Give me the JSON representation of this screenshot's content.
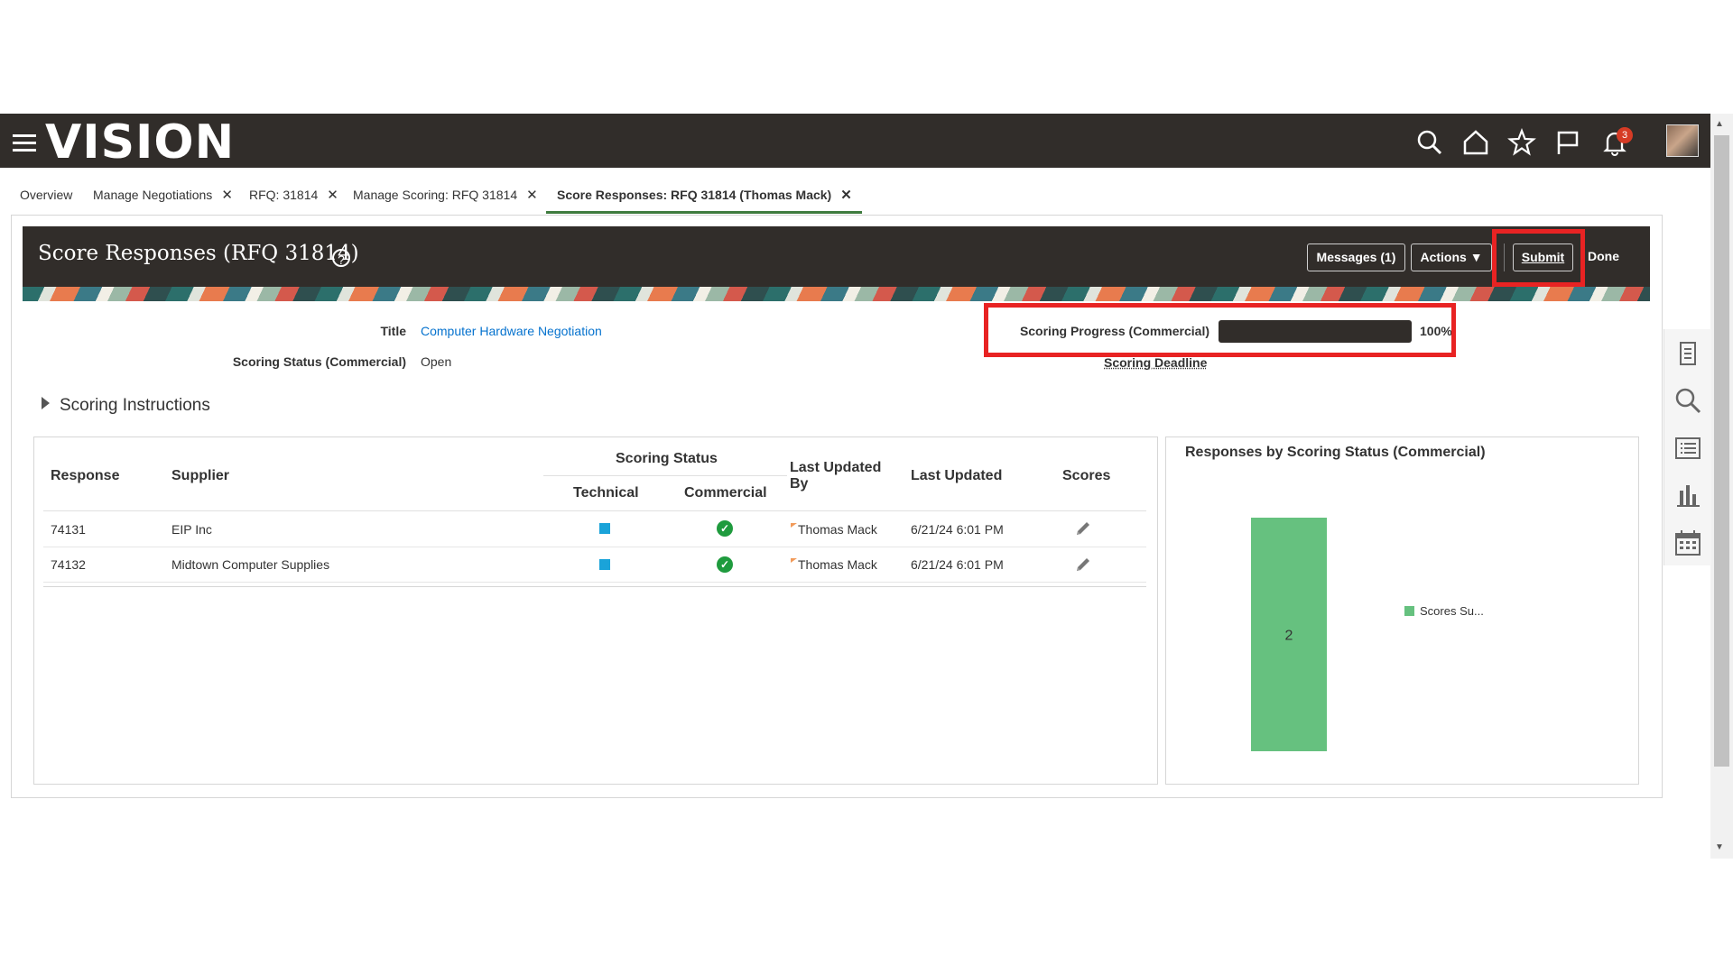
{
  "header": {
    "logo": "VISION",
    "notifications_count": "3",
    "icons": [
      "menu-icon",
      "search-icon",
      "home-icon",
      "star-icon",
      "flag-icon",
      "bell-icon",
      "avatar"
    ]
  },
  "tabs": [
    {
      "label": "Overview",
      "closable": false
    },
    {
      "label": "Manage Negotiations",
      "closable": true
    },
    {
      "label": "RFQ: 31814",
      "closable": true
    },
    {
      "label": "Manage Scoring: RFQ 31814",
      "closable": true
    },
    {
      "label": "Score Responses: RFQ 31814 (Thomas Mack)",
      "closable": true,
      "active": true
    }
  ],
  "page": {
    "title": "Score Responses (RFQ 31814)",
    "help": "?",
    "buttons": {
      "messages": "Messages (1)",
      "actions": "Actions",
      "submit": "Submit",
      "done": "Done"
    }
  },
  "fields": {
    "title_label": "Title",
    "title_value": "Computer Hardware Negotiation",
    "status_label": "Scoring Status (Commercial)",
    "status_value": "Open",
    "progress_label": "Scoring Progress (Commercial)",
    "progress_value": "100%",
    "progress_fraction": 1.0,
    "deadline_label": "Scoring Deadline"
  },
  "instructions": {
    "label": "Scoring Instructions"
  },
  "table": {
    "headers": {
      "response": "Response",
      "supplier": "Supplier",
      "scoring_status": "Scoring Status",
      "technical": "Technical",
      "commercial": "Commercial",
      "last_updated_by_1": "Last Updated",
      "last_updated_by_2": "By",
      "last_updated": "Last Updated",
      "scores": "Scores"
    },
    "rows": [
      {
        "response": "74131",
        "supplier": "EIP Inc",
        "technical": "in-progress",
        "commercial": "complete",
        "updated_by": "Thomas Mack",
        "updated": "6/21/24 6:01 PM"
      },
      {
        "response": "74132",
        "supplier": "Midtown Computer Supplies",
        "technical": "in-progress",
        "commercial": "complete",
        "updated_by": "Thomas Mack",
        "updated": "6/21/24 6:01 PM"
      }
    ]
  },
  "chart": {
    "title": "Responses by Scoring Status (Commercial)",
    "legend_label": "Scores Su...",
    "color": "#66c17f"
  },
  "chart_data": {
    "type": "bar",
    "categories": [
      ""
    ],
    "series": [
      {
        "name": "Scores Su...",
        "values": [
          2
        ]
      }
    ],
    "title": "Responses by Scoring Status (Commercial)",
    "data_labels": [
      "2"
    ],
    "ylim": [
      0,
      2
    ],
    "legend": "right",
    "grid": false
  }
}
